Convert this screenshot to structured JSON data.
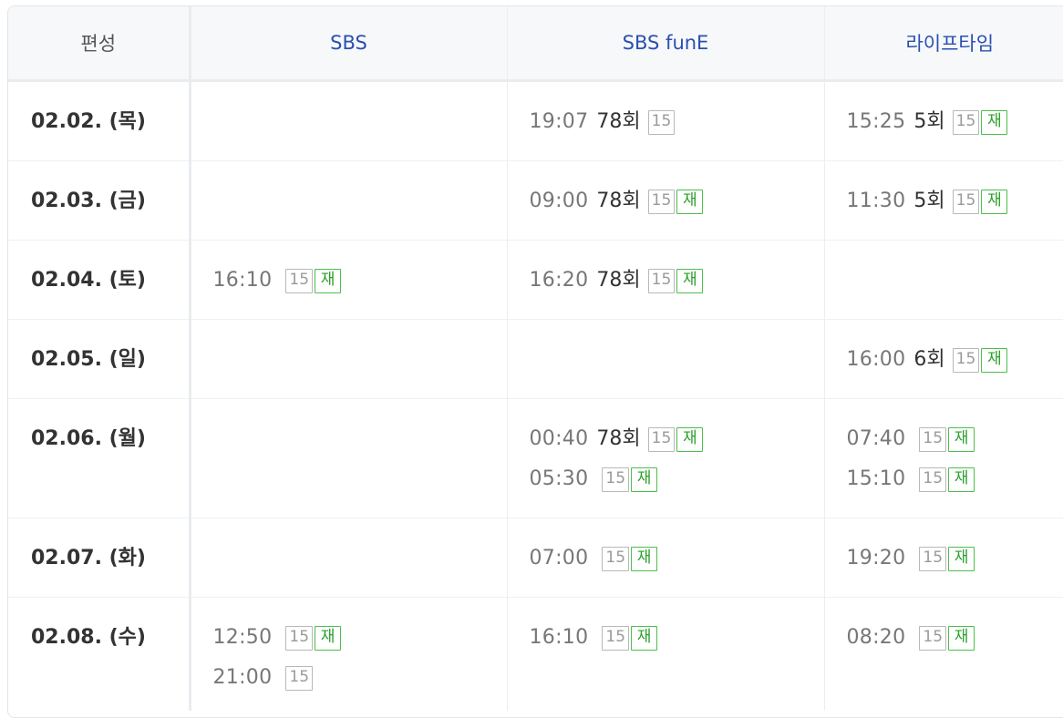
{
  "header": {
    "corner": "편성",
    "channels": [
      "SBS",
      "SBS funE",
      "라이프타임"
    ]
  },
  "labels": {
    "rating": "15",
    "rerun": "재"
  },
  "colors": {
    "channel_header": "#2a4fb1",
    "rerun_badge": "#2ba02b",
    "rating_badge": "#9a9a9a",
    "time_text": "#777777"
  },
  "rows": [
    {
      "day": "02.02. (목)",
      "cells": [
        [],
        [
          {
            "time": "19:07",
            "episode": "78회",
            "rating": true,
            "rerun": false
          }
        ],
        [
          {
            "time": "15:25",
            "episode": "5회",
            "rating": true,
            "rerun": true
          }
        ]
      ]
    },
    {
      "day": "02.03. (금)",
      "cells": [
        [],
        [
          {
            "time": "09:00",
            "episode": "78회",
            "rating": true,
            "rerun": true
          }
        ],
        [
          {
            "time": "11:30",
            "episode": "5회",
            "rating": true,
            "rerun": true
          }
        ]
      ]
    },
    {
      "day": "02.04. (토)",
      "cells": [
        [
          {
            "time": "16:10",
            "episode": "",
            "rating": true,
            "rerun": true
          }
        ],
        [
          {
            "time": "16:20",
            "episode": "78회",
            "rating": true,
            "rerun": true
          }
        ],
        []
      ]
    },
    {
      "day": "02.05. (일)",
      "cells": [
        [],
        [],
        [
          {
            "time": "16:00",
            "episode": "6회",
            "rating": true,
            "rerun": true
          }
        ]
      ]
    },
    {
      "day": "02.06. (월)",
      "cells": [
        [],
        [
          {
            "time": "00:40",
            "episode": "78회",
            "rating": true,
            "rerun": true
          },
          {
            "time": "05:30",
            "episode": "",
            "rating": true,
            "rerun": true
          }
        ],
        [
          {
            "time": "07:40",
            "episode": "",
            "rating": true,
            "rerun": true
          },
          {
            "time": "15:10",
            "episode": "",
            "rating": true,
            "rerun": true
          }
        ]
      ]
    },
    {
      "day": "02.07. (화)",
      "cells": [
        [],
        [
          {
            "time": "07:00",
            "episode": "",
            "rating": true,
            "rerun": true
          }
        ],
        [
          {
            "time": "19:20",
            "episode": "",
            "rating": true,
            "rerun": true
          }
        ]
      ]
    },
    {
      "day": "02.08. (수)",
      "cells": [
        [
          {
            "time": "12:50",
            "episode": "",
            "rating": true,
            "rerun": true
          },
          {
            "time": "21:00",
            "episode": "",
            "rating": true,
            "rerun": false
          }
        ],
        [
          {
            "time": "16:10",
            "episode": "",
            "rating": true,
            "rerun": true
          }
        ],
        [
          {
            "time": "08:20",
            "episode": "",
            "rating": true,
            "rerun": true
          }
        ]
      ]
    }
  ]
}
